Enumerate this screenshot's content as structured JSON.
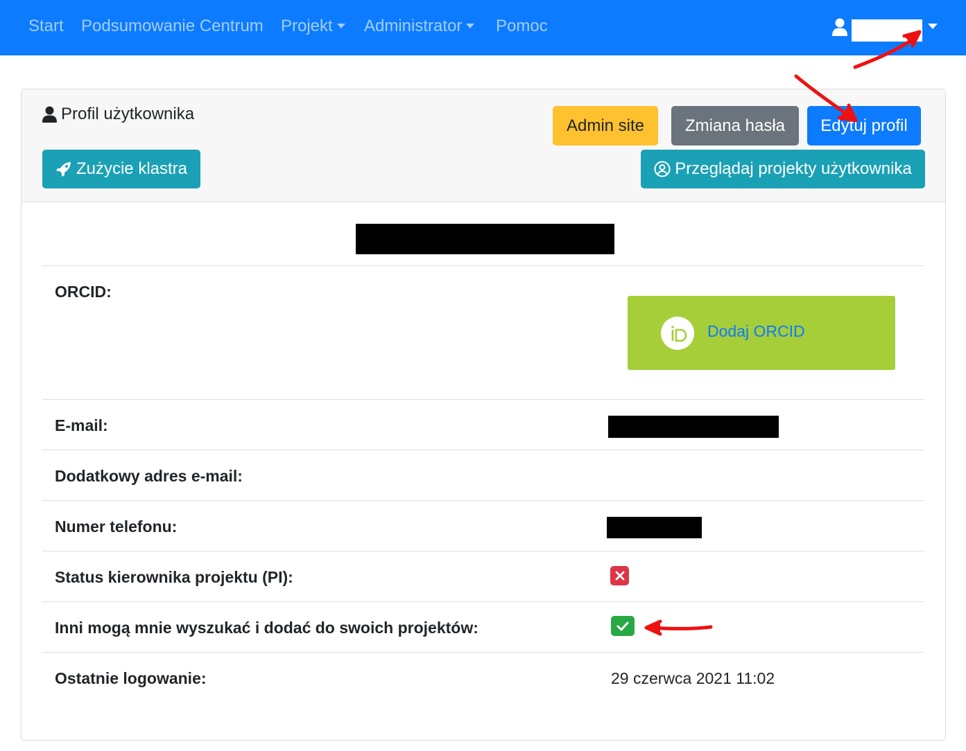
{
  "navbar": {
    "items": [
      {
        "label": "Start",
        "dropdown": false
      },
      {
        "label": "Podsumowanie Centrum",
        "dropdown": false
      },
      {
        "label": "Projekt",
        "dropdown": true
      },
      {
        "label": "Administrator",
        "dropdown": true
      },
      {
        "label": "Pomoc",
        "dropdown": false
      }
    ],
    "user_icon": "user-icon",
    "background": "#0d7bfe"
  },
  "card": {
    "title": "Profil użytkownika",
    "title_icon": "user-icon",
    "buttons": {
      "admin_site": "Admin site",
      "change_password": "Zmiana hasła",
      "edit_profile": "Edytuj profil",
      "cluster_usage": "Zużycie klastra",
      "browse_projects": "Przeglądaj projekty użytkownika"
    },
    "button_colors": {
      "warning": "#fec12f",
      "secondary": "#6b737c",
      "primary": "#0d7bfe",
      "info": "#1ba1b6"
    }
  },
  "profile": {
    "orcid_label": "ORCID:",
    "orcid_button": "Dodaj ORCID",
    "orcid_icon": "orcid-icon",
    "orcid_color": "#a6ce39",
    "email_label": "E-mail:",
    "extra_email_label": "Dodatkowy adres e-mail:",
    "phone_label": "Numer telefonu:",
    "pi_status_label": "Status kierownika projektu (PI):",
    "pi_status_icon": "x-icon",
    "pi_status": false,
    "searchable_label": "Inni mogą mnie wyszukać i dodać do swoich projektów:",
    "searchable_icon": "check-icon",
    "searchable": true,
    "last_login_label": "Ostatnie logowanie:",
    "last_login_value": "29 czerwca 2021 11:02"
  }
}
